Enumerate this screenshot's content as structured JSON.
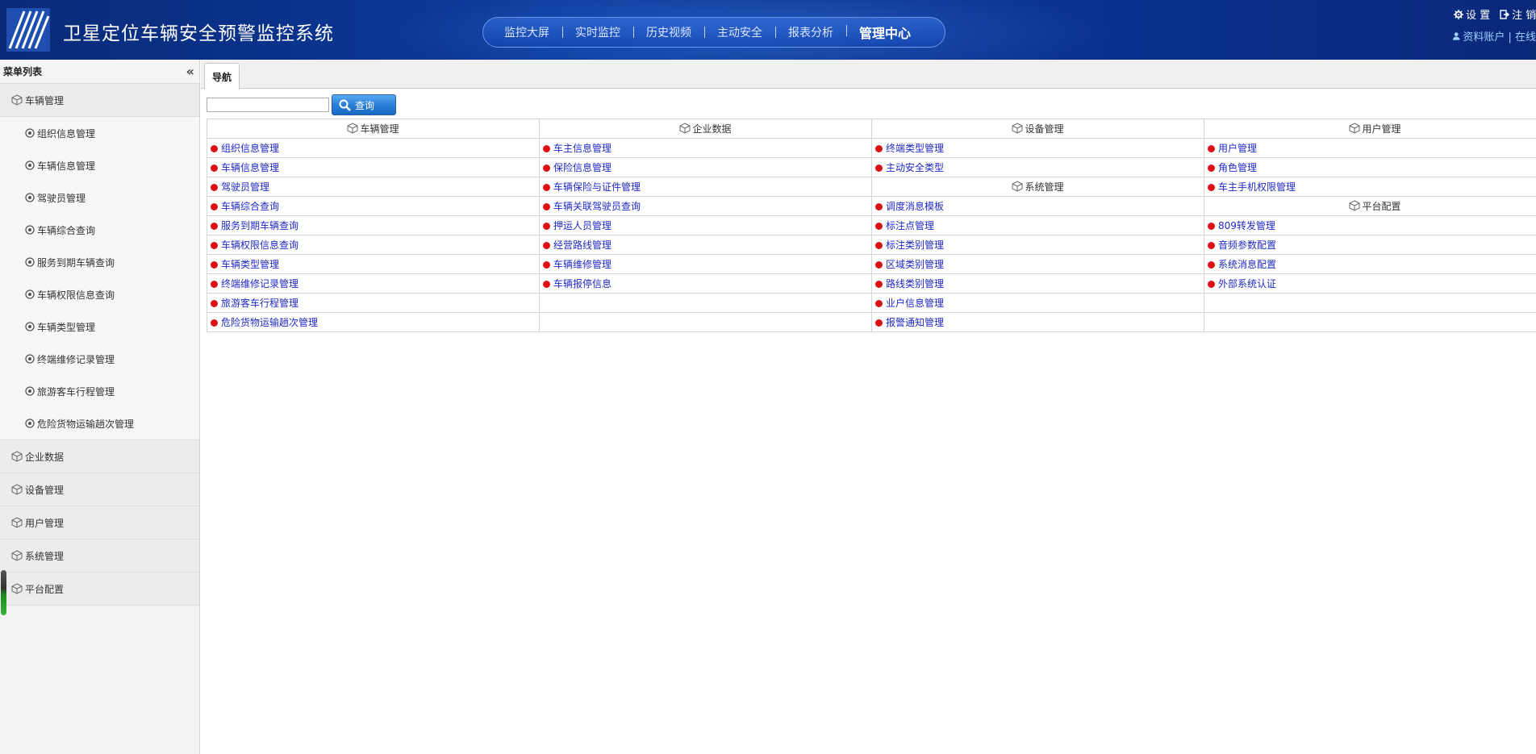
{
  "header": {
    "title": "卫星定位车辆安全预警监控系统",
    "nav": [
      "监控大屏",
      "实时监控",
      "历史视频",
      "主动安全",
      "报表分析",
      "管理中心"
    ],
    "active_nav": "管理中心",
    "settings_label": "设 置",
    "logout_label": "注 销",
    "account_text": "资料账户 | 在线"
  },
  "sidebar": {
    "title": "菜单列表",
    "groups": [
      {
        "label": "车辆管理",
        "items": [
          "组织信息管理",
          "车辆信息管理",
          "驾驶员管理",
          "车辆综合查询",
          "服务到期车辆查询",
          "车辆权限信息查询",
          "车辆类型管理",
          "终端维修记录管理",
          "旅游客车行程管理",
          "危险货物运输趟次管理"
        ]
      },
      {
        "label": "企业数据"
      },
      {
        "label": "设备管理"
      },
      {
        "label": "用户管理"
      },
      {
        "label": "系统管理"
      },
      {
        "label": "平台配置"
      }
    ]
  },
  "main": {
    "tab_label": "导航",
    "search": {
      "value": "",
      "button_label": "查询"
    },
    "table": {
      "headers": [
        "车辆管理",
        "企业数据",
        "设备管理",
        "用户管理"
      ],
      "rows": [
        [
          {
            "t": "link",
            "v": "组织信息管理"
          },
          {
            "t": "link",
            "v": "车主信息管理"
          },
          {
            "t": "link",
            "v": "终端类型管理"
          },
          {
            "t": "link",
            "v": "用户管理"
          }
        ],
        [
          {
            "t": "link",
            "v": "车辆信息管理"
          },
          {
            "t": "link",
            "v": "保险信息管理"
          },
          {
            "t": "link",
            "v": "主动安全类型"
          },
          {
            "t": "link",
            "v": "角色管理"
          }
        ],
        [
          {
            "t": "link",
            "v": "驾驶员管理"
          },
          {
            "t": "link",
            "v": "车辆保险与证件管理"
          },
          {
            "t": "cat",
            "v": "系统管理"
          },
          {
            "t": "link",
            "v": "车主手机权限管理"
          }
        ],
        [
          {
            "t": "link",
            "v": "车辆综合查询"
          },
          {
            "t": "link",
            "v": "车辆关联驾驶员查询"
          },
          {
            "t": "link",
            "v": "调度消息模板"
          },
          {
            "t": "cat",
            "v": "平台配置"
          }
        ],
        [
          {
            "t": "link",
            "v": "服务到期车辆查询"
          },
          {
            "t": "link",
            "v": "押运人员管理"
          },
          {
            "t": "link",
            "v": "标注点管理"
          },
          {
            "t": "link",
            "v": "809转发管理"
          }
        ],
        [
          {
            "t": "link",
            "v": "车辆权限信息查询"
          },
          {
            "t": "link",
            "v": "经营路线管理"
          },
          {
            "t": "link",
            "v": "标注类别管理"
          },
          {
            "t": "link",
            "v": "音频参数配置"
          }
        ],
        [
          {
            "t": "link",
            "v": "车辆类型管理"
          },
          {
            "t": "link",
            "v": "车辆维修管理"
          },
          {
            "t": "link",
            "v": "区域类别管理"
          },
          {
            "t": "link",
            "v": "系统消息配置"
          }
        ],
        [
          {
            "t": "link",
            "v": "终端维修记录管理"
          },
          {
            "t": "link",
            "v": "车辆报停信息"
          },
          {
            "t": "link",
            "v": "路线类别管理"
          },
          {
            "t": "link",
            "v": "外部系统认证"
          }
        ],
        [
          {
            "t": "link",
            "v": "旅游客车行程管理"
          },
          {
            "t": "empty",
            "v": ""
          },
          {
            "t": "link",
            "v": "业户信息管理"
          },
          {
            "t": "empty",
            "v": ""
          }
        ],
        [
          {
            "t": "link",
            "v": "危险货物运输趟次管理"
          },
          {
            "t": "empty",
            "v": ""
          },
          {
            "t": "link",
            "v": "报警通知管理"
          },
          {
            "t": "empty",
            "v": ""
          }
        ]
      ]
    }
  },
  "colors": {
    "header_bg": "#0b3a9c",
    "link": "#1f2ac4",
    "dot": "#dd1111",
    "button": "#2a7fd6"
  },
  "icons": {
    "group": "box-icon",
    "sub_item": "eye-icon",
    "search": "magnifier-icon",
    "settings": "gear-icon",
    "logout": "logout-icon",
    "user": "user-icon"
  }
}
